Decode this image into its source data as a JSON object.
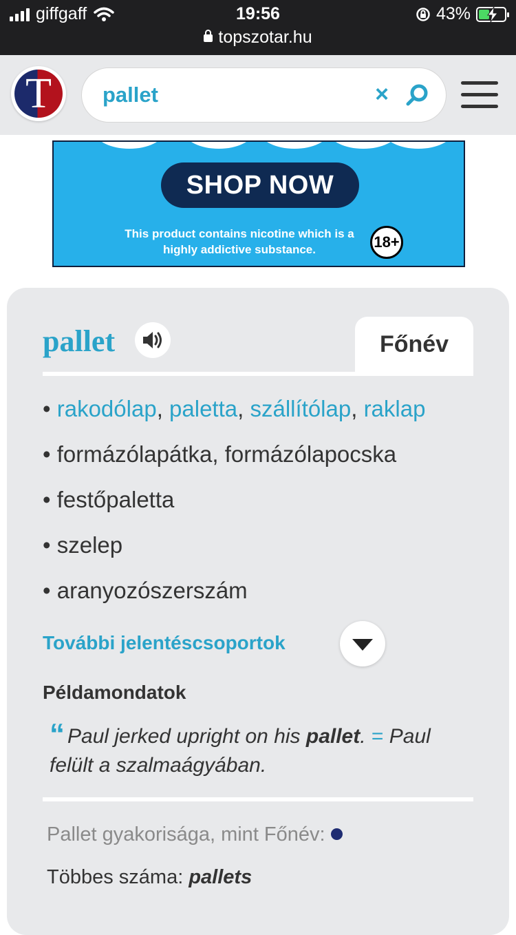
{
  "status_bar": {
    "carrier": "giffgaff",
    "time": "19:56",
    "battery": "43%",
    "url": "topszotar.hu"
  },
  "header": {
    "logo_letter": "T",
    "search_value": "pallet",
    "clear_label": "×"
  },
  "ad": {
    "cta": "SHOP NOW",
    "disclaimer": "This product contains nicotine which is a highly addictive substance.",
    "age_badge": "18+"
  },
  "entry": {
    "headword": "pallet",
    "part_of_speech": "Főnév",
    "senses": [
      {
        "bullet": "•",
        "links": [
          "rakodólap",
          "paletta",
          "szállítólap",
          "raklap"
        ]
      },
      {
        "bullet": "•",
        "text": "formázólapátka, formázólapocska"
      },
      {
        "bullet": "•",
        "text": "festőpaletta"
      },
      {
        "bullet": "•",
        "text": "szelep"
      },
      {
        "bullet": "•",
        "text": "aranyozószerszám"
      }
    ],
    "more_groups_label": "További jelentéscsoportok",
    "examples_heading": "Példamondatok",
    "example": {
      "quote_mark": "“",
      "source_before": "Paul jerked upright on his ",
      "source_bold": "pallet",
      "source_after": ".",
      "equals": "=",
      "translation": "Paul felült a szalmaágyában."
    },
    "frequency_label": "Pallet gyakorisága, mint Főnév:",
    "plural_label": "Többes száma:",
    "plural_value": "pallets"
  },
  "colors": {
    "accent": "#2aa3c9",
    "status_bar_bg": "#1f1f21",
    "card_bg": "#e8e9eb",
    "ad_bg": "#27b0ea",
    "battery_fill": "#4cd964",
    "frequency_dot": "#1f2c72"
  },
  "icons": {
    "signal": "signal-icon",
    "wifi": "wifi-icon",
    "lock": "lock-icon",
    "rotation_lock": "rotation-lock-icon",
    "battery": "battery-charging-icon",
    "search": "search-icon",
    "clear": "close-icon",
    "menu": "hamburger-menu-icon",
    "speaker": "speaker-icon",
    "expand": "chevron-down-icon"
  }
}
